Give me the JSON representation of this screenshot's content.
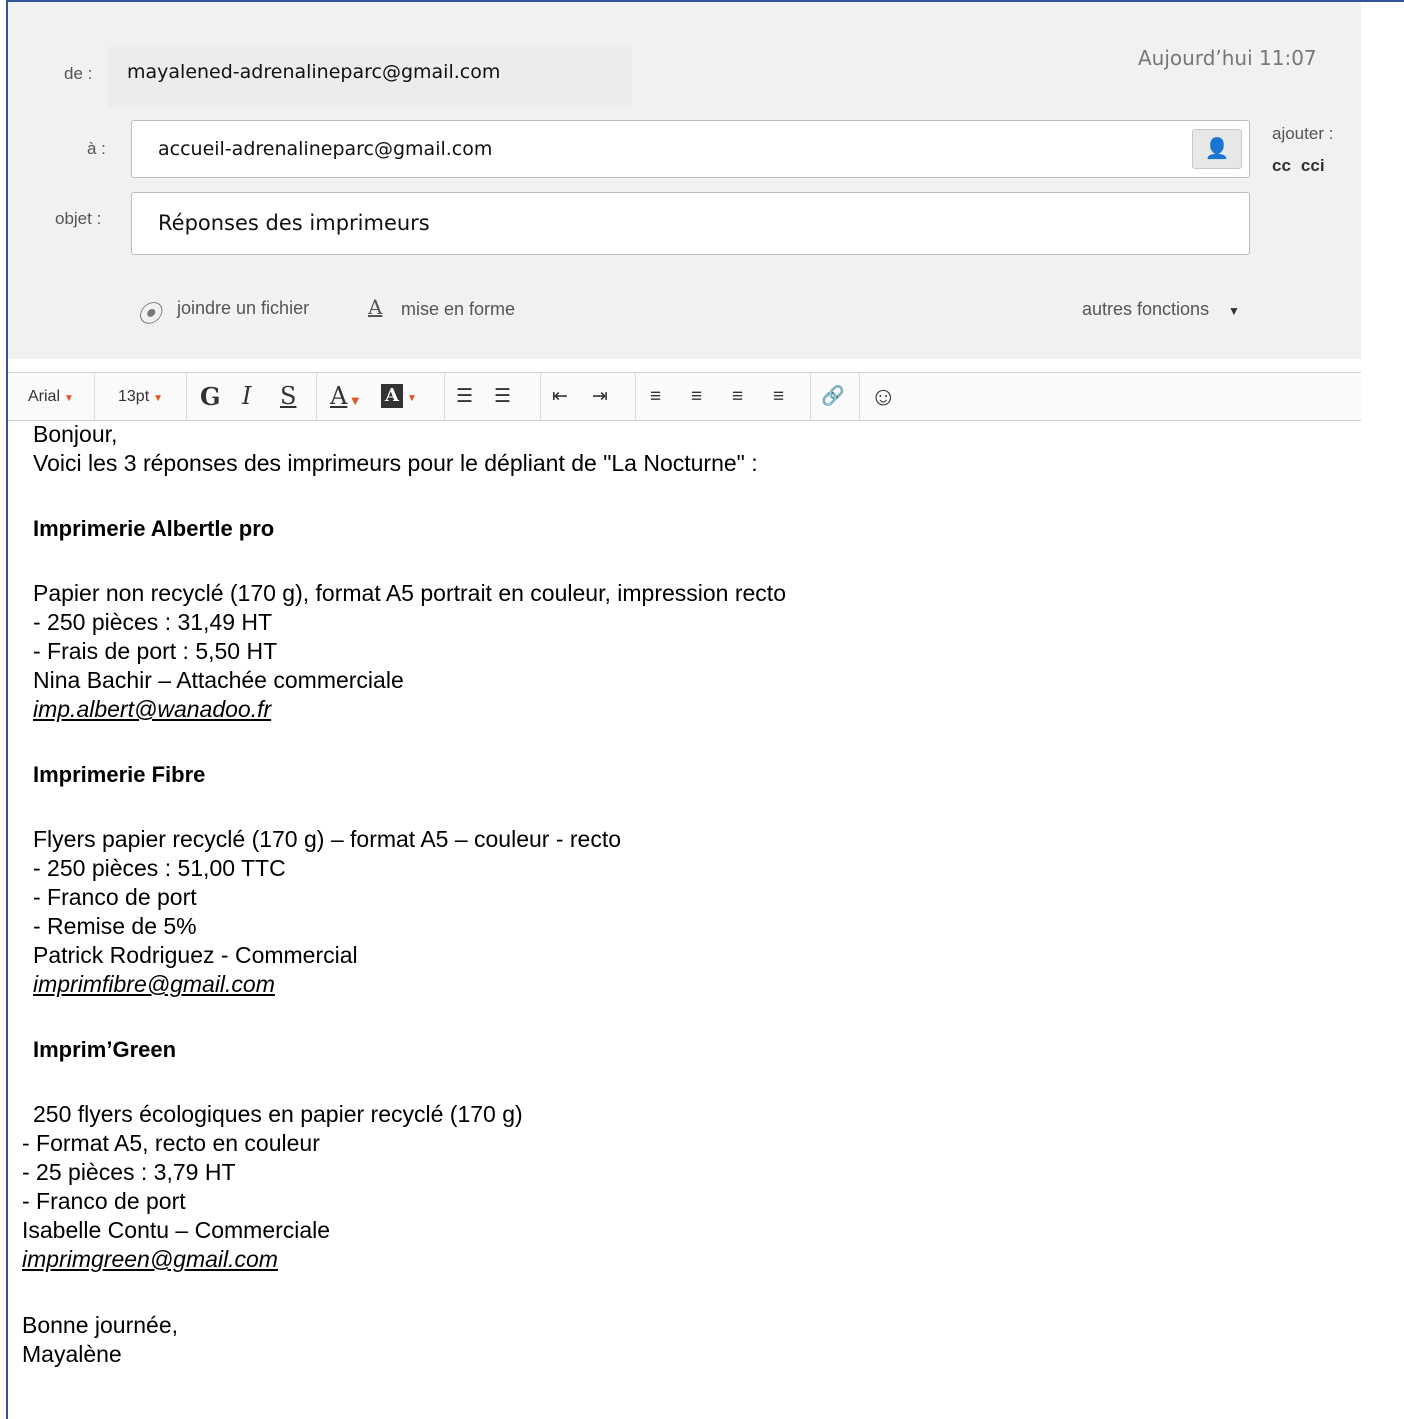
{
  "header": {
    "from_label": "de :",
    "from_value": "mayalened-adrenalineparc@gmail.com",
    "date": "Aujourd’hui 11:07",
    "to_label": "à :",
    "to_value": "accueil-adrenalineparc@gmail.com",
    "subject_label": "objet :",
    "subject_value": "Réponses des imprimeurs",
    "add_label": "ajouter :",
    "cc": "cc",
    "cci": "cci",
    "attach_label": "joindre un fichier",
    "format_icon": "A",
    "format_label": "mise en forme",
    "more_label": "autres fonctions"
  },
  "toolbar": {
    "font": "Arial",
    "size": "13pt",
    "bold": "G",
    "italic": "I",
    "strike": "S",
    "text_color": "A",
    "bg_color": "A",
    "icons": [
      "numbered-list-icon",
      "bullet-list-icon",
      "outdent-icon",
      "indent-icon",
      "align-left-icon",
      "align-center-icon",
      "align-right-icon",
      "justify-icon",
      "link-icon",
      "emoji-icon"
    ]
  },
  "body": {
    "greeting": "Bonjour,",
    "intro": "Voici les 3 réponses des imprimeurs pour le dépliant de \"La Nocturne\" :",
    "printer1_name": "Imprimerie Albertle pro",
    "printer1_line1": "Papier non recyclé (170 g), format A5 portrait en couleur, impression recto",
    "printer1_line2": "- 250 pièces : 31,49 HT",
    "printer1_line3": "- Frais de port : 5,50 HT",
    "printer1_contact": "Nina Bachir – Attachée commerciale",
    "printer1_email": "imp.albert@wanadoo.fr",
    "printer2_name": "Imprimerie Fibre",
    "printer2_line1": "Flyers papier recyclé (170 g) – format A5 – couleur - recto",
    "printer2_line2": "- 250 pièces : 51,00 TTC",
    "printer2_line3": "- Franco de port",
    "printer2_line4": "- Remise de 5%",
    "printer2_contact": "Patrick Rodriguez - Commercial",
    "printer2_email": "imprimfibre@gmail.com",
    "printer3_name": "Imprim’Green",
    "printer3_line1": "250 flyers écologiques en papier recyclé (170 g)",
    "printer3_line2": "- Format A5, recto en couleur",
    "printer3_line3": "- 25 pièces : 3,79 HT",
    "printer3_line4": "- Franco de port",
    "printer3_contact": "Isabelle Contu – Commerciale",
    "printer3_email": "imprimgreen@gmail.com",
    "closing": "Bonne journée,",
    "signature": "Mayalène"
  }
}
